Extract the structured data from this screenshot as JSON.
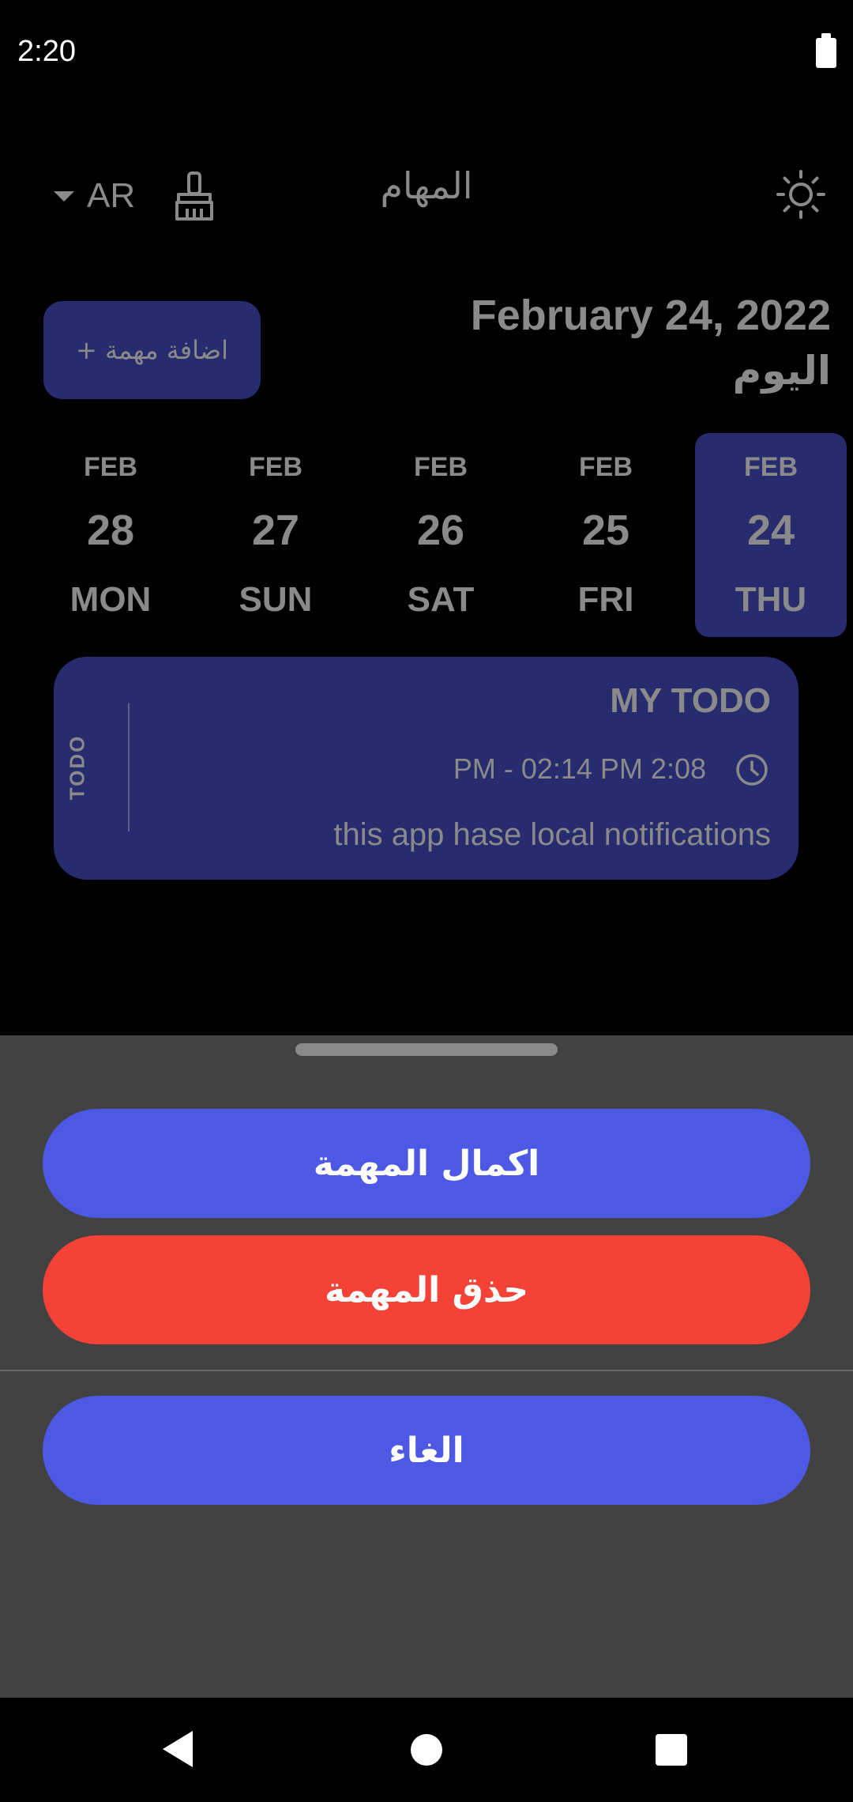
{
  "status_bar": {
    "time": "2:20",
    "battery_icon": "battery-full-icon"
  },
  "app_bar": {
    "language": "AR",
    "language_caret_icon": "caret-down-icon",
    "clear_icon": "broom-icon",
    "title": "المهام",
    "theme_icon": "sun-icon"
  },
  "header": {
    "add_task_label": "+ اضافة مهمة",
    "date": "February 24, 2022",
    "today_label": "اليوم"
  },
  "date_strip": [
    {
      "month": "FEB",
      "day": "28",
      "weekday": "MON",
      "selected": false
    },
    {
      "month": "FEB",
      "day": "27",
      "weekday": "SUN",
      "selected": false
    },
    {
      "month": "FEB",
      "day": "26",
      "weekday": "SAT",
      "selected": false
    },
    {
      "month": "FEB",
      "day": "25",
      "weekday": "FRI",
      "selected": false
    },
    {
      "month": "FEB",
      "day": "24",
      "weekday": "THU",
      "selected": true
    }
  ],
  "task": {
    "title": "MY TODO",
    "time": "PM - 02:14 PM 2:08",
    "time_icon": "clock-icon",
    "note": "this app hase local notifications",
    "status": "TODO"
  },
  "sheet": {
    "complete_label": "اكمال المهمة",
    "delete_label": "حذق المهمة",
    "cancel_label": "الغاء"
  },
  "colors": {
    "accent": "#4d59e4",
    "danger": "#f44336",
    "card": "#262c6d",
    "sheet": "#424242",
    "background": "#000000"
  },
  "nav_bar": {
    "back_icon": "back-triangle-icon",
    "home_icon": "home-circle-icon",
    "recents_icon": "recents-square-icon"
  }
}
